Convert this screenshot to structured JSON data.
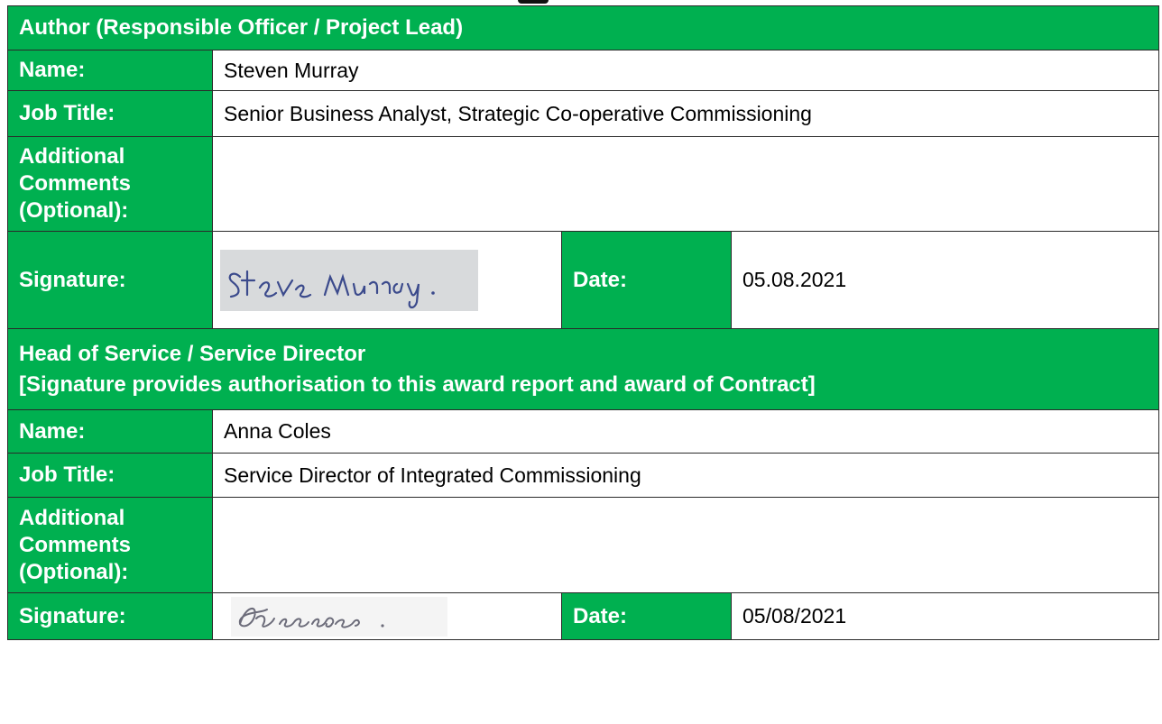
{
  "author_section": {
    "heading": "Author (Responsible Officer / Project Lead)",
    "name_label": "Name:",
    "name_value": "Steven Murray",
    "job_label": "Job Title:",
    "job_value": "Senior Business Analyst, Strategic Co-operative Commissioning",
    "comments_label_lines": [
      "Additional",
      "Comments",
      "(Optional):"
    ],
    "comments_value": "",
    "signature_label": "Signature:",
    "signature_text": "Steve Murray.",
    "date_label": "Date:",
    "date_value": "05.08.2021"
  },
  "director_section": {
    "heading": "Head of Service / Service Director",
    "subheading": "[Signature provides authorisation to this award report and award of Contract]",
    "name_label": "Name:",
    "name_value": "Anna Coles",
    "job_label": "Job Title:",
    "job_value": "Service Director of Integrated Commissioning",
    "comments_label_lines": [
      "Additional",
      "Comments",
      "(Optional):"
    ],
    "comments_value": "",
    "signature_label": "Signature:",
    "signature_text": "ACoeas .",
    "date_label": "Date:",
    "date_value": "05/08/2021"
  }
}
